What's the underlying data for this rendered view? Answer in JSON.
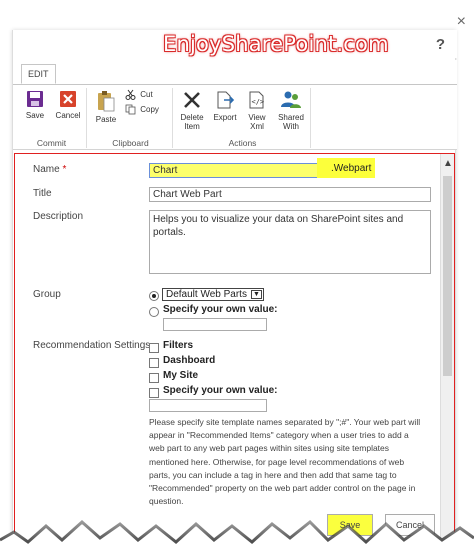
{
  "close_glyph": "×",
  "watermark": "EnjoySharePoint.com",
  "help": "?",
  "ribbon": {
    "tab": "EDIT",
    "groups": {
      "commit": {
        "label": "Commit",
        "save": "Save",
        "cancel": "Cancel"
      },
      "clipboard": {
        "label": "Clipboard",
        "paste": "Paste",
        "cut": "Cut",
        "copy": "Copy"
      },
      "actions": {
        "label": "Actions",
        "delete_1": "Delete",
        "delete_2": "Item",
        "export": "Export",
        "view_1": "View",
        "view_2": "Xml",
        "shared_1": "Shared",
        "shared_2": "With"
      }
    }
  },
  "form": {
    "name_label": "Name",
    "required_mark": "*",
    "name_value": "Chart",
    "name_suffix": ".Webpart",
    "title_label": "Title",
    "title_value": "Chart Web Part",
    "description_label": "Description",
    "description_value": "Helps you to visualize your data on SharePoint sites and portals.",
    "group_label": "Group",
    "group_selected": "Default Web Parts",
    "group_custom": "Specify your own value:",
    "rec_label": "Recommendation Settings",
    "rec_filters": "Filters",
    "rec_dashboard": "Dashboard",
    "rec_mysite": "My Site",
    "rec_custom": "Specify your own value:",
    "note_1": "Please specify site template names separated by \";#\". Your web part will",
    "note_2": "appear in \"Recommended Items\" category when a user tries to add a",
    "note_3": "web part to any web part pages within sites using site templates",
    "note_4": "mentioned here. Otherwise, for page level recommendations of web",
    "note_5": "parts, you can include a tag in here and then add that same tag to",
    "note_6": "\"Recommended\" property on the web part adder control on the page in",
    "note_7": "question.",
    "save_button": "Save",
    "cancel_button": "Cancel"
  },
  "colors": {
    "highlight": "#fcff3b",
    "border_red": "#e02020",
    "watermark_red": "#d92a2a",
    "icon_purple": "#6b2c91",
    "icon_red": "#d7432b",
    "icon_blue": "#2b6cb0"
  }
}
